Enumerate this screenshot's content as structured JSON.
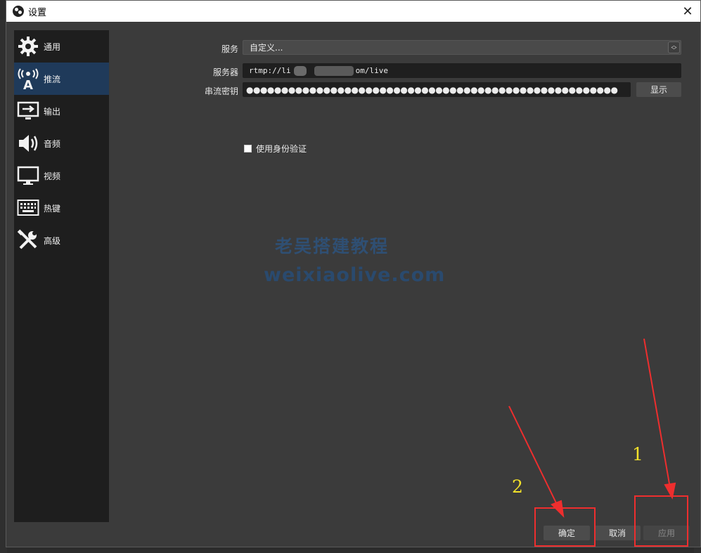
{
  "window": {
    "title": "设置"
  },
  "sidebar": {
    "items": [
      {
        "label": "通用",
        "icon": "gear-icon"
      },
      {
        "label": "推流",
        "icon": "broadcast-antenna-icon",
        "active": true
      },
      {
        "label": "输出",
        "icon": "output-monitor-icon"
      },
      {
        "label": "音频",
        "icon": "speaker-icon"
      },
      {
        "label": "视频",
        "icon": "monitor-icon"
      },
      {
        "label": "热键",
        "icon": "keyboard-icon"
      },
      {
        "label": "高级",
        "icon": "tools-icon"
      }
    ]
  },
  "form": {
    "service_label": "服务",
    "service_value": "自定义...",
    "server_label": "服务器",
    "server_value_prefix": "rtmp://li",
    "server_value_suffix": "om/live",
    "stream_key_label": "串流密钥",
    "stream_key_masked": "●●●●●●●●●●●●●●●●●●●●●●●●●●●●●●●●●●●●●●●●●●●●●●●●●●●●●",
    "show_button": "显示",
    "use_auth_label": "使用身份验证"
  },
  "watermark": {
    "line1": "老吴搭建教程",
    "line2": "weixiaolive.com"
  },
  "footer": {
    "ok": "确定",
    "cancel": "取消",
    "apply": "应用"
  },
  "annotations": {
    "label_1": "1",
    "label_2": "2",
    "color": "#ee2e2e",
    "number_color": "#f2e12a"
  },
  "colors": {
    "sidebar_active": "#1f3a5a",
    "dialog_bg": "#3b3b3b",
    "sidebar_bg": "#1e1e1e"
  }
}
